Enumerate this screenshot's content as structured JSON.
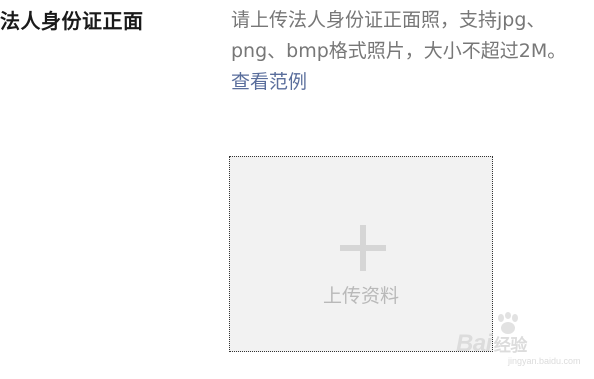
{
  "field": {
    "label": "法人身份证正面",
    "hint": "请上传法人身份证正面照，支持jpg、png、bmp格式照片，大小不超过2M。",
    "example_link": "查看范例"
  },
  "upload": {
    "icon": "plus-icon",
    "label": "上传资料"
  },
  "watermark": {
    "brand": "Bai",
    "brand_suffix": "经验",
    "url": "jingyan.baidu.com"
  },
  "colors": {
    "label_text": "#1a1a1a",
    "hint_text": "#777777",
    "link": "#5a6e9c",
    "upload_bg": "#f2f2f2",
    "upload_icon": "#d6d6d6",
    "upload_label": "#b9b9b9"
  }
}
